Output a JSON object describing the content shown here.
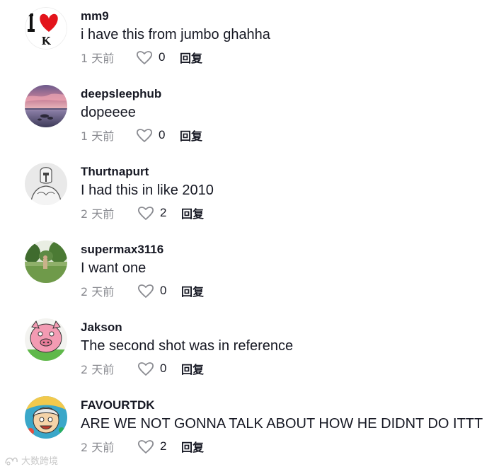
{
  "comments": [
    {
      "username": "mm9",
      "text": "i have this from jumbo ghahha",
      "time": "1 天前",
      "likes": "0",
      "reply": "回复",
      "avatar": "i-heart-k-logo"
    },
    {
      "username": "deepsleephub",
      "text": "dopeeee",
      "time": "1 天前",
      "likes": "0",
      "reply": "回复",
      "avatar": "sunset-lake-photo"
    },
    {
      "username": "Thurtnapurt",
      "text": "I had this in like 2010",
      "time": "2 天前",
      "likes": "2",
      "reply": "回复",
      "avatar": "sketch-figure-drawing"
    },
    {
      "username": "supermax3116",
      "text": "I want one",
      "time": "2 天前",
      "likes": "0",
      "reply": "回复",
      "avatar": "park-photo"
    },
    {
      "username": "Jakson",
      "text": "The second shot was in reference",
      "time": "2 天前",
      "likes": "0",
      "reply": "回复",
      "avatar": "pink-pig-cartoon"
    },
    {
      "username": "FAVOURTDK",
      "text": "ARE WE NOT GONNA TALK ABOUT HOW HE DIDNT DO ITTT",
      "time": "2 天前",
      "likes": "2",
      "reply": "回复",
      "avatar": "cartoon-character"
    }
  ],
  "watermark": {
    "text": "大数跨境"
  },
  "colors": {
    "text": "#161823",
    "muted": "#8a8b91",
    "heart": "#8a8b91"
  }
}
